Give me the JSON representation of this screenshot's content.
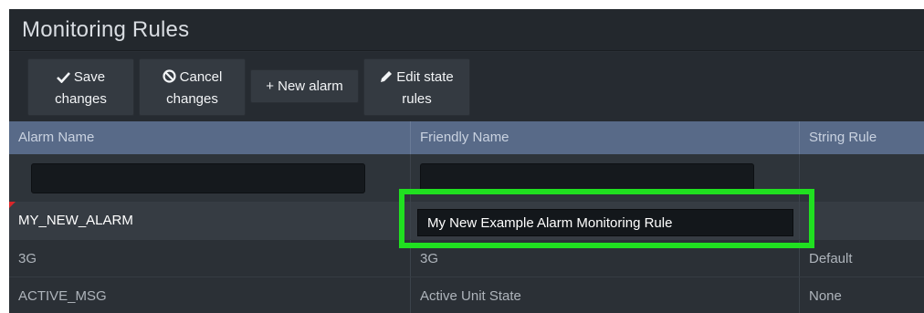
{
  "window": {
    "title": "Monitoring Rules"
  },
  "toolbar": {
    "save": {
      "line1": "Save",
      "line2": "changes",
      "icon": "check-icon"
    },
    "cancel": {
      "line1": "Cancel",
      "line2": "changes",
      "icon": "no-entry-icon"
    },
    "new_alarm": {
      "label": "+ New alarm",
      "icon": "plus-icon"
    },
    "edit_state": {
      "line1": "Edit state",
      "line2": "rules",
      "icon": "pencil-icon"
    }
  },
  "table": {
    "columns": [
      "Alarm Name",
      "Friendly Name",
      "String Rule"
    ],
    "filters": {
      "alarm_name": "",
      "friendly_name": ""
    },
    "editing_row": {
      "alarm_name": "MY_NEW_ALARM",
      "friendly_name": "My New Example Alarm Monitoring Rule",
      "string_rule": ""
    },
    "rows": [
      {
        "alarm_name": "3G",
        "friendly_name": "3G",
        "string_rule": "Default"
      },
      {
        "alarm_name": "ACTIVE_MSG",
        "friendly_name": "Active Unit State",
        "string_rule": "None"
      }
    ]
  },
  "colors": {
    "header_bg": "#586a88",
    "highlight": "#20e020",
    "dirty_marker": "#d9262a"
  }
}
